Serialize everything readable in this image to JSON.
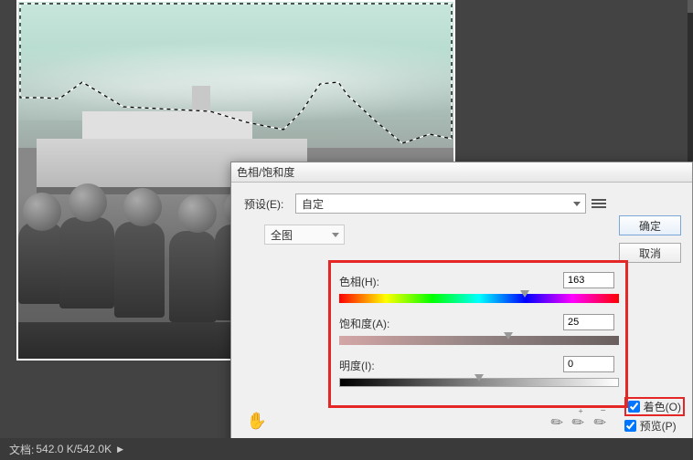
{
  "status_bar": {
    "label": "文档:",
    "value": "542.0 K/542.0K"
  },
  "dialog": {
    "title": "色相/饱和度",
    "preset_label": "预设(E):",
    "preset_value": "自定",
    "master_label": "全图",
    "hue": {
      "label": "色相(H):",
      "value": "163"
    },
    "saturation": {
      "label": "饱和度(A):",
      "value": "25"
    },
    "lightness": {
      "label": "明度(I):",
      "value": "0"
    },
    "colorize": "着色(O)",
    "preview": "预览(P)",
    "ok": "确定",
    "cancel": "取消"
  }
}
